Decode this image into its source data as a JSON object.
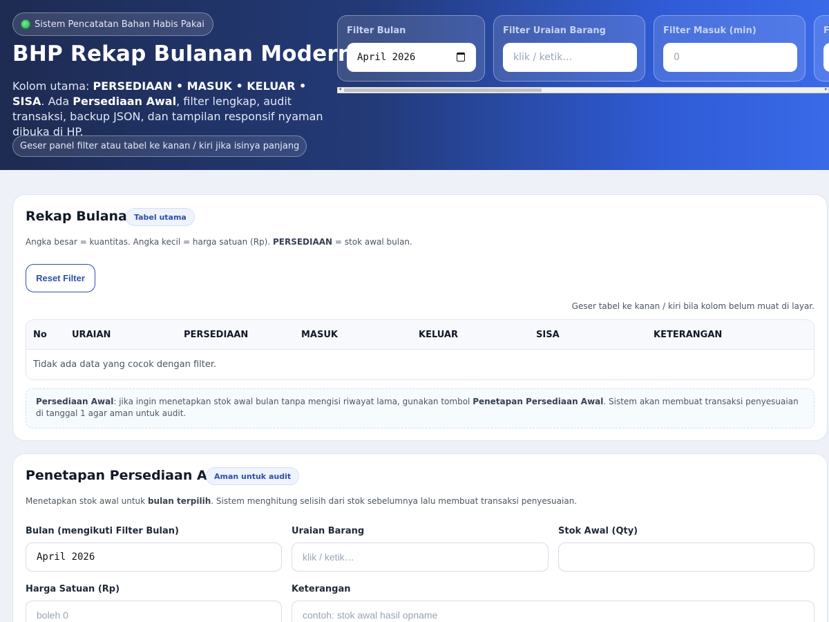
{
  "header": {
    "status_pill": "Sistem Pencatatan Bahan Habis Pakai",
    "title": "BHP Rekap Bulanan Modern",
    "desc_prefix": "Kolom utama: ",
    "desc_columns": "PERSEDIAAN • MASUK • KELUAR • SISA",
    "desc_mid": ". Ada ",
    "desc_bold2": "Persediaan Awal",
    "desc_suffix": ", filter lengkap, audit transaksi, backup JSON, dan tampilan responsif nyaman dibuka di HP.",
    "hint": "Geser panel filter atau tabel ke kanan / kiri jika isinya panjang"
  },
  "filters": {
    "month_label": "Filter Bulan",
    "month_value": "April 2026",
    "item_label": "Filter Uraian Barang",
    "item_placeholder": "klik / ketik…",
    "in_label": "Filter Masuk (min)",
    "in_placeholder": "0",
    "next_label_partial": "F"
  },
  "rekap": {
    "title": "Rekap Bulanan",
    "tag": "Tabel utama",
    "desc_main": "Angka besar = kuantitas. Angka kecil = harga satuan (Rp). ",
    "desc_bold": "PERSEDIAAN",
    "desc_end": " = stok awal bulan.",
    "reset_label": "Reset Filter",
    "table_hint": "Geser tabel ke kanan / kiri bila kolom belum muat di layar.",
    "columns": [
      "No",
      "URAIAN",
      "PERSEDIAAN",
      "MASUK",
      "KELUAR",
      "SISA",
      "KETERANGAN"
    ],
    "empty_text": "Tidak ada data yang cocok dengan filter.",
    "note_bold1": "Persediaan Awal",
    "note_mid": ": jika ingin menetapkan stok awal bulan tanpa mengisi riwayat lama, gunakan tombol ",
    "note_bold2": "Penetapan Persediaan Awal",
    "note_end": ". Sistem akan membuat transaksi penyesuaian di tanggal 1 agar aman untuk audit."
  },
  "penetapan": {
    "title": "Penetapan Persediaan Awal",
    "tag": "Aman untuk audit",
    "desc_start": "Menetapkan stok awal untuk ",
    "desc_bold": "bulan terpilih",
    "desc_end": ". Sistem menghitung selisih dari stok sebelumnya lalu membuat transaksi penyesuaian.",
    "month_label": "Bulan (mengikuti Filter Bulan)",
    "month_value": "April 2026",
    "item_label": "Uraian Barang",
    "item_placeholder": "klik / ketik…",
    "stock_label": "Stok Awal (Qty)",
    "stock_value": "",
    "price_label": "Harga Satuan (Rp)",
    "price_placeholder": "boleh 0",
    "note_label": "Keterangan",
    "note_placeholder": "contoh: stok awal hasil opname"
  },
  "colors": {
    "accent": "#2c4fa8",
    "hero_start": "#1e2b52",
    "hero_end": "#3a6ae8",
    "status_dot": "#22b04b"
  }
}
